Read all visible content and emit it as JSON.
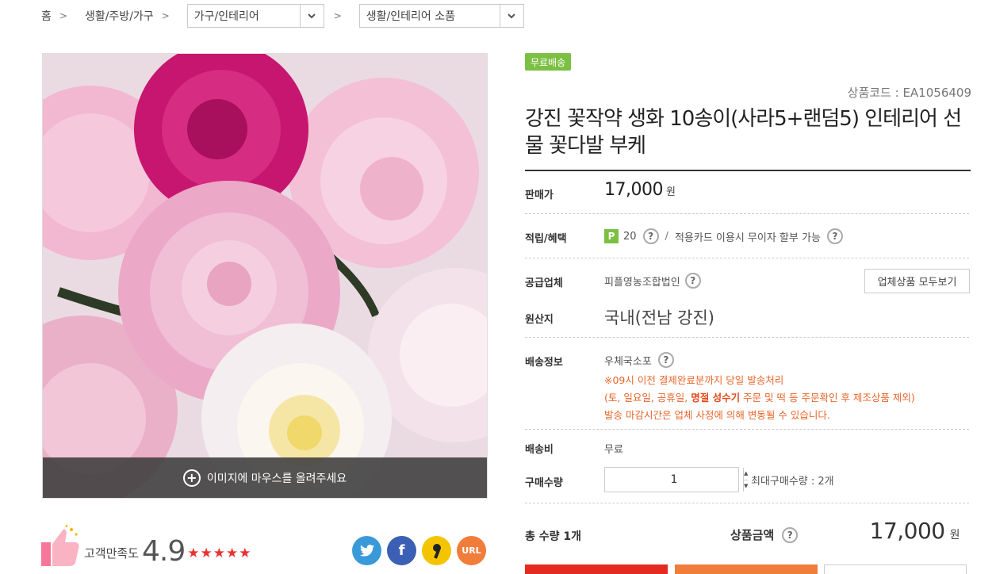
{
  "breadcrumb": {
    "home": "홈",
    "level1": "생활/주방/가구",
    "select1": "가구/인테리어",
    "select2": "생활/인테리어 소품"
  },
  "gallery": {
    "hover_hint": "이미지에 마우스를 올려주세요"
  },
  "satisfaction": {
    "label": "고객만족도",
    "score": "4.9",
    "stars": "★★★★★"
  },
  "share": {
    "url_label": "URL"
  },
  "product": {
    "badge": "무료배송",
    "code": "상품코드 : EA1056409",
    "title": "강진 꽃작약 생화 10송이(사라5+랜덤5) 인테리어 선물 꽃다발 부케"
  },
  "info": {
    "price_label": "판매가",
    "price_value": "17,000",
    "price_unit": "원",
    "benefit_label": "적립/혜택",
    "point_badge": "P",
    "point_value": "20",
    "benefit_slash": "/",
    "benefit_card": "적용카드 이용시 무이자 할부 가능",
    "supplier_label": "공급업체",
    "supplier_value": "피플영농조합법인",
    "supplier_button": "업체상품 모두보기",
    "origin_label": "원산지",
    "origin_value": "국내(전남 강진)",
    "shipping_label": "배송정보",
    "shipping_value": "우체국소포",
    "shipping_note1": "※09시 이전 결제완료분까지 당일 발송처리",
    "shipping_note2_pre": "(토, 일요일, 공휴일, ",
    "shipping_note2_bold": "명절 성수기",
    "shipping_note2_post": " 주문 및 떡 등 주문확인 후 제조상품 제외)",
    "shipping_note3": "발송 마감시간은 업체 사정에 의해 변동될 수 있습니다.",
    "fee_label": "배송비",
    "fee_value": "무료",
    "qty_label": "구매수량",
    "qty_value": "1",
    "max_qty": "최대구매수량 : 2개"
  },
  "total": {
    "qty_label": "총 수량",
    "qty_value": "1개",
    "amount_label": "상품금액",
    "amount_value": "17,000",
    "amount_unit": "원"
  },
  "colors": {
    "accent_red": "#e32b22",
    "accent_orange": "#f07d3a",
    "badge_green": "#7bc043"
  }
}
